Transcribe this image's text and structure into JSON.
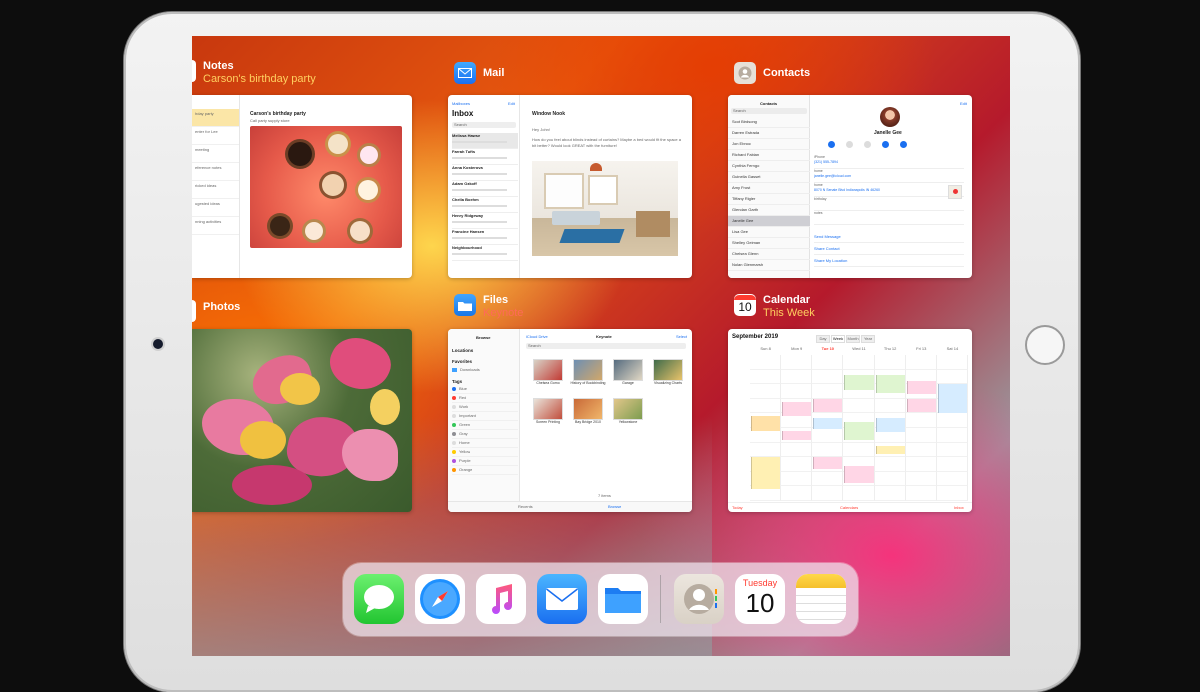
{
  "apps": {
    "notes": {
      "title": "Notes",
      "subtitle": "Carson's birthday party",
      "note_title": "Carson's birthday party",
      "note_sub": "Call party supply store",
      "list": [
        "hday party",
        "enter for Lee",
        "meeting",
        "eference notes",
        "ricked ideas",
        "ugested ideas",
        "nning activities"
      ]
    },
    "mail": {
      "title": "Mail",
      "back": "Mailboxes",
      "edit": "Edit",
      "inbox": "Inbox",
      "search": "Search",
      "subject": "Window Nook",
      "greeting": "Hey John!",
      "body": "How do you feel about blinds instead of curtains? Maybe a bed would fit the space a bit better? Would look GREAT with the furniture!",
      "senders": [
        "Melissa Hawse",
        "Farrah Tufts",
        "Anna Kosterova",
        "Adam Ozkoff",
        "Chella Boehm",
        "Henry Ridgeway",
        "Francine Hansen",
        "Neighbourhood"
      ]
    },
    "contacts": {
      "title": "Contacts",
      "list_title": "Contacts",
      "search": "Search",
      "edit": "Edit",
      "name": "Janelle Gee",
      "names": [
        "Scot Birdsong",
        "Darren Estrada",
        "Jon Ebnoc",
        "Richard Fabian",
        "Cynthia Ferngo",
        "Guinella Gasset",
        "Amy Frost",
        "Tiffany Rigler",
        "Glendan Garth",
        "Janelle Gee",
        "Lisa Gee",
        "Shelley Geiman",
        "Chelsea Glenn",
        "Nolan Glenmarsh"
      ],
      "field_labels": [
        "iPhone",
        "home",
        "home",
        "birthday",
        "notes"
      ],
      "field_values": [
        "(321) 555-7894",
        "janelle.gee@icloud.com",
        "8070 N Senate Blvd Indianapolis IN 46260",
        "",
        ""
      ],
      "actions": [
        "Send Message",
        "Share Contact",
        "Share My Location"
      ]
    },
    "photos": {
      "title": "Photos"
    },
    "files": {
      "title": "Files",
      "subtitle": "Keynote",
      "browse": "Browse",
      "back": "iCloud Drive",
      "folder": "Keynote",
      "select": "Select",
      "search": "Search",
      "sections": [
        "Locations",
        "Favorites",
        "Tags"
      ],
      "favorites": [
        "Downloads"
      ],
      "tags": [
        "Blue",
        "Red",
        "Work",
        "Important",
        "Green",
        "Gray",
        "Home",
        "Yellow",
        "Purple",
        "Orange"
      ],
      "items": [
        "Chelsea Gomo",
        "History of Bookbinding",
        "Garage",
        "Visualizing Charts",
        "Screen Printing",
        "Bay Bridge 2010",
        "Yellowstone",
        ""
      ],
      "count": "7 items",
      "tab_recents": "Recents",
      "tab_browse": "Browse"
    },
    "calendar": {
      "title": "Calendar",
      "subtitle": "This Week",
      "month": "September 2019",
      "segments": [
        "Day",
        "Week",
        "Month",
        "Year"
      ],
      "days": [
        "Sun 8",
        "Mon 9",
        "Tue 10",
        "Wed 11",
        "Thu 12",
        "Fri 13",
        "Sat 14"
      ],
      "today_label": "Today",
      "calendars_label": "Calendars",
      "inbox_label": "Inbox"
    }
  },
  "dock": {
    "icons": [
      "messages-icon",
      "safari-icon",
      "music-icon",
      "mail-icon",
      "files-icon",
      "contacts-icon",
      "calendar-icon",
      "notes-icon"
    ],
    "calendar_day": "Tuesday",
    "calendar_date": "10"
  },
  "colors": {
    "ios_blue": "#1a6ff0",
    "notes_yellow": "#f5c02c",
    "calendar_red": "#ff3b30",
    "subtitle_yellow": "#ffd060"
  }
}
